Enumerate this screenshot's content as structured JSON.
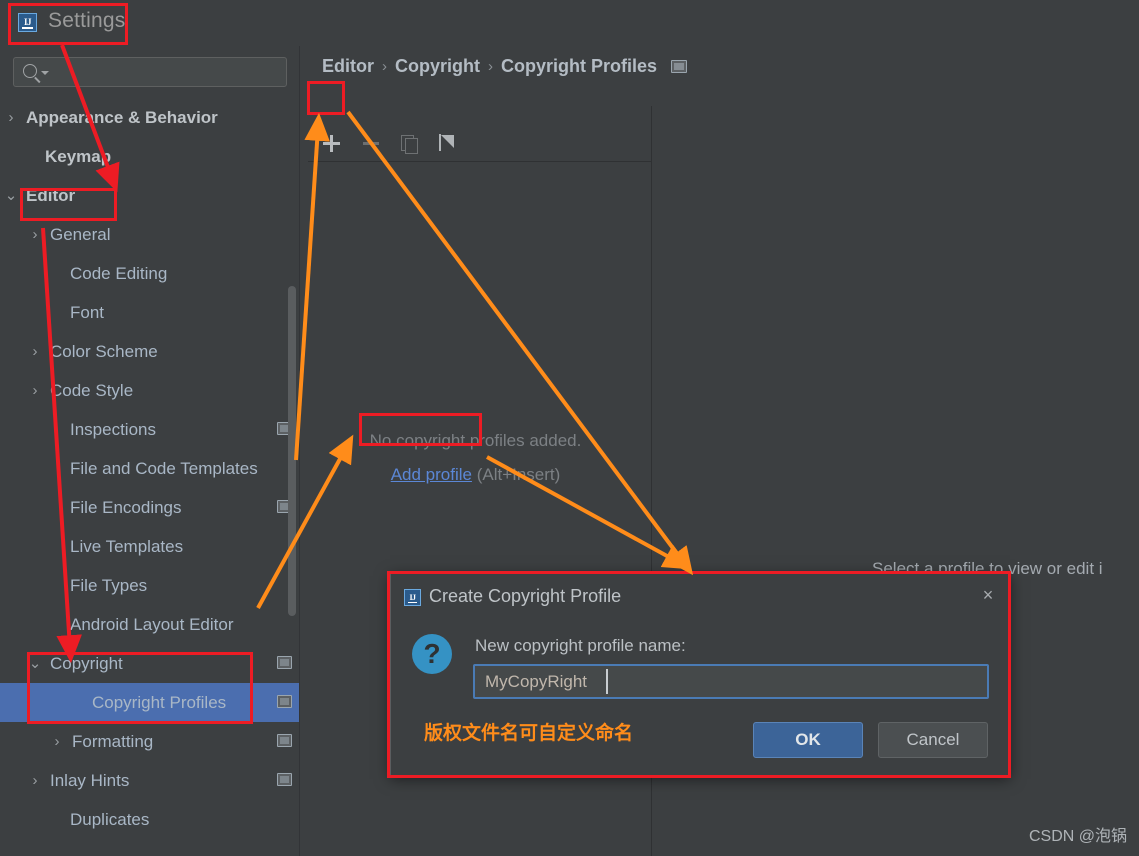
{
  "window": {
    "title": "Settings",
    "app_icon": "intellij-idea-icon"
  },
  "sidebar": {
    "search": {
      "value": "",
      "placeholder": ""
    },
    "items": [
      {
        "label": "Appearance & Behavior",
        "indent": 26,
        "arrow": "›",
        "bold": true,
        "selected": false,
        "scope_icon": false
      },
      {
        "label": "Keymap",
        "indent": 45,
        "arrow": "",
        "bold": true,
        "selected": false,
        "scope_icon": false
      },
      {
        "label": "Editor",
        "indent": 26,
        "arrow": "⌄",
        "bold": true,
        "selected": false,
        "scope_icon": false
      },
      {
        "label": "General",
        "indent": 50,
        "arrow": "›",
        "bold": false,
        "selected": false,
        "scope_icon": false
      },
      {
        "label": "Code Editing",
        "indent": 70,
        "arrow": "",
        "bold": false,
        "selected": false,
        "scope_icon": false
      },
      {
        "label": "Font",
        "indent": 70,
        "arrow": "",
        "bold": false,
        "selected": false,
        "scope_icon": false
      },
      {
        "label": "Color Scheme",
        "indent": 50,
        "arrow": "›",
        "bold": false,
        "selected": false,
        "scope_icon": false
      },
      {
        "label": "Code Style",
        "indent": 50,
        "arrow": "›",
        "bold": false,
        "selected": false,
        "scope_icon": false
      },
      {
        "label": "Inspections",
        "indent": 70,
        "arrow": "",
        "bold": false,
        "selected": false,
        "scope_icon": true
      },
      {
        "label": "File and Code Templates",
        "indent": 70,
        "arrow": "",
        "bold": false,
        "selected": false,
        "scope_icon": false
      },
      {
        "label": "File Encodings",
        "indent": 70,
        "arrow": "",
        "bold": false,
        "selected": false,
        "scope_icon": true
      },
      {
        "label": "Live Templates",
        "indent": 70,
        "arrow": "",
        "bold": false,
        "selected": false,
        "scope_icon": false
      },
      {
        "label": "File Types",
        "indent": 70,
        "arrow": "",
        "bold": false,
        "selected": false,
        "scope_icon": false
      },
      {
        "label": "Android Layout Editor",
        "indent": 70,
        "arrow": "",
        "bold": false,
        "selected": false,
        "scope_icon": false
      },
      {
        "label": "Copyright",
        "indent": 50,
        "arrow": "⌄",
        "bold": false,
        "selected": false,
        "scope_icon": true
      },
      {
        "label": "Copyright Profiles",
        "indent": 92,
        "arrow": "",
        "bold": false,
        "selected": true,
        "scope_icon": true
      },
      {
        "label": "Formatting",
        "indent": 72,
        "arrow": "›",
        "bold": false,
        "selected": false,
        "scope_icon": true
      },
      {
        "label": "Inlay Hints",
        "indent": 50,
        "arrow": "›",
        "bold": false,
        "selected": false,
        "scope_icon": true
      },
      {
        "label": "Duplicates",
        "indent": 70,
        "arrow": "",
        "bold": false,
        "selected": false,
        "scope_icon": false
      }
    ]
  },
  "main": {
    "breadcrumb": [
      "Editor",
      "Copyright",
      "Copyright Profiles"
    ],
    "breadcrumb_separator": "›",
    "toolbar": [
      {
        "name": "add-profile-button",
        "icon": "plus-icon",
        "enabled": true
      },
      {
        "name": "remove-profile-button",
        "icon": "minus-icon",
        "enabled": false
      },
      {
        "name": "copy-profile-button",
        "icon": "copy-icon",
        "enabled": false
      },
      {
        "name": "import-profile-button",
        "icon": "import-icon",
        "enabled": true
      }
    ],
    "empty_state": {
      "message": "No copyright profiles added.",
      "link": "Add profile",
      "shortcut": " (Alt+Insert)"
    },
    "right_panel_hint": "Select a profile to view or edit i"
  },
  "dialog": {
    "title": "Create Copyright Profile",
    "icon": "question-icon",
    "close_label": "×",
    "field_label": "New copyright profile name:",
    "field_value": "MyCopyRight",
    "annotation_note": "版权文件名可自定义命名",
    "ok_label": "OK",
    "cancel_label": "Cancel"
  },
  "watermark": {
    "text": "CSDN @泡锅"
  },
  "colors": {
    "background": "#3c3f41",
    "selection": "#4b6eaf",
    "accent_blue": "#5b87d6",
    "ok_button": "#3c6498",
    "annotation_red": "#ed1c24",
    "annotation_orange": "#ff8c1a",
    "question_icon": "#3592c4"
  }
}
